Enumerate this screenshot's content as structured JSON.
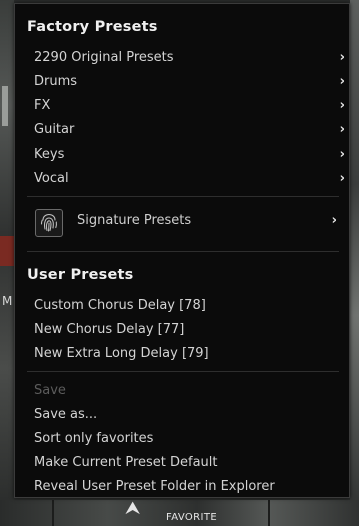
{
  "background": {
    "left_glyph": "M",
    "bottom_label": "FAVORITE",
    "bottom_arrow": "⮝"
  },
  "menu": {
    "factory_header": "Factory Presets",
    "factory_items": [
      {
        "label": "2290 Original Presets",
        "chevron": "›"
      },
      {
        "label": "Drums",
        "chevron": "›"
      },
      {
        "label": "FX",
        "chevron": "›"
      },
      {
        "label": "Guitar",
        "chevron": "›"
      },
      {
        "label": "Keys",
        "chevron": "›"
      },
      {
        "label": "Vocal",
        "chevron": "›"
      }
    ],
    "signature": {
      "label": "Signature Presets",
      "chevron": "›",
      "icon": "fingerprint-icon"
    },
    "user_header": "User Presets",
    "user_items": [
      {
        "label": "Custom Chorus Delay [78]"
      },
      {
        "label": "New Chorus Delay [77]"
      },
      {
        "label": "New Extra Long Delay [79]"
      }
    ],
    "actions": [
      {
        "label": "Save",
        "disabled": true
      },
      {
        "label": "Save as..."
      },
      {
        "label": "Sort only favorites"
      },
      {
        "label": "Make Current Preset Default"
      },
      {
        "label": "Reveal User Preset Folder in Explorer"
      }
    ]
  },
  "colors": {
    "menu_bg": "#0b0b0b",
    "header_text": "#f0f0f0",
    "item_text": "#d4d4d4",
    "disabled_text": "#5c5c5c"
  }
}
